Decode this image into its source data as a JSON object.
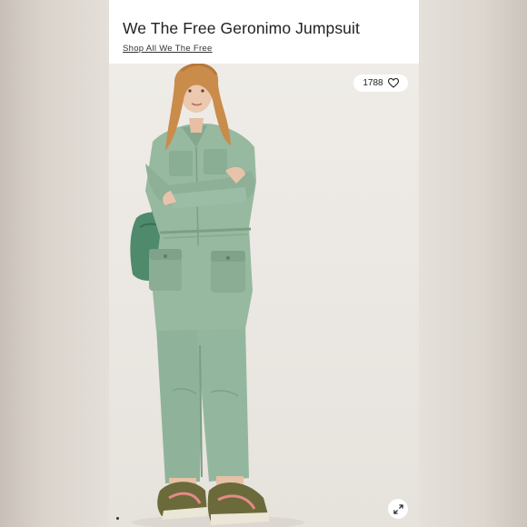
{
  "listing": {
    "title": "We The Free Geronimo Jumpsuit",
    "shop_link": "Shop All We The Free",
    "likes": "1788"
  },
  "icons": {
    "like": "heart-outline-icon",
    "expand": "expand-arrows-icon",
    "carousel": "carousel-dot-icon"
  },
  "colors": {
    "jumpsuit": "#8fb39a",
    "hair": "#c98c4a",
    "sneakers": "#6b6a3a",
    "sneaker_stripe": "#e48a86"
  }
}
